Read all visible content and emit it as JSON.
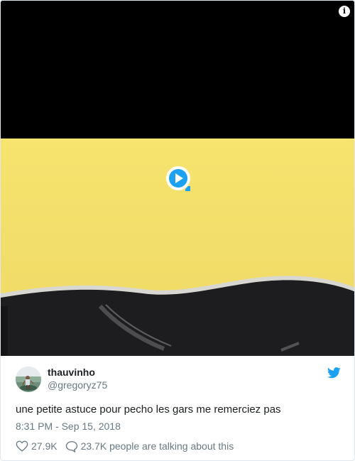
{
  "media": {
    "info_glyph": "i",
    "play_icon": "play-icon"
  },
  "author": {
    "display_name": "thauvinho",
    "screen_name": "@gregoryz75",
    "avatar": "avatar"
  },
  "tweet": {
    "text": "une petite astuce pour pecho les gars me remerciez pas",
    "timestamp": "8:31 PM - Sep 15, 2018"
  },
  "actions": {
    "likes": "27.9K",
    "replies_text": "23.7K people are talking about this"
  },
  "colors": {
    "accent": "#1da1f2",
    "muted": "#697882",
    "video_yellow": "#f4e06a"
  }
}
